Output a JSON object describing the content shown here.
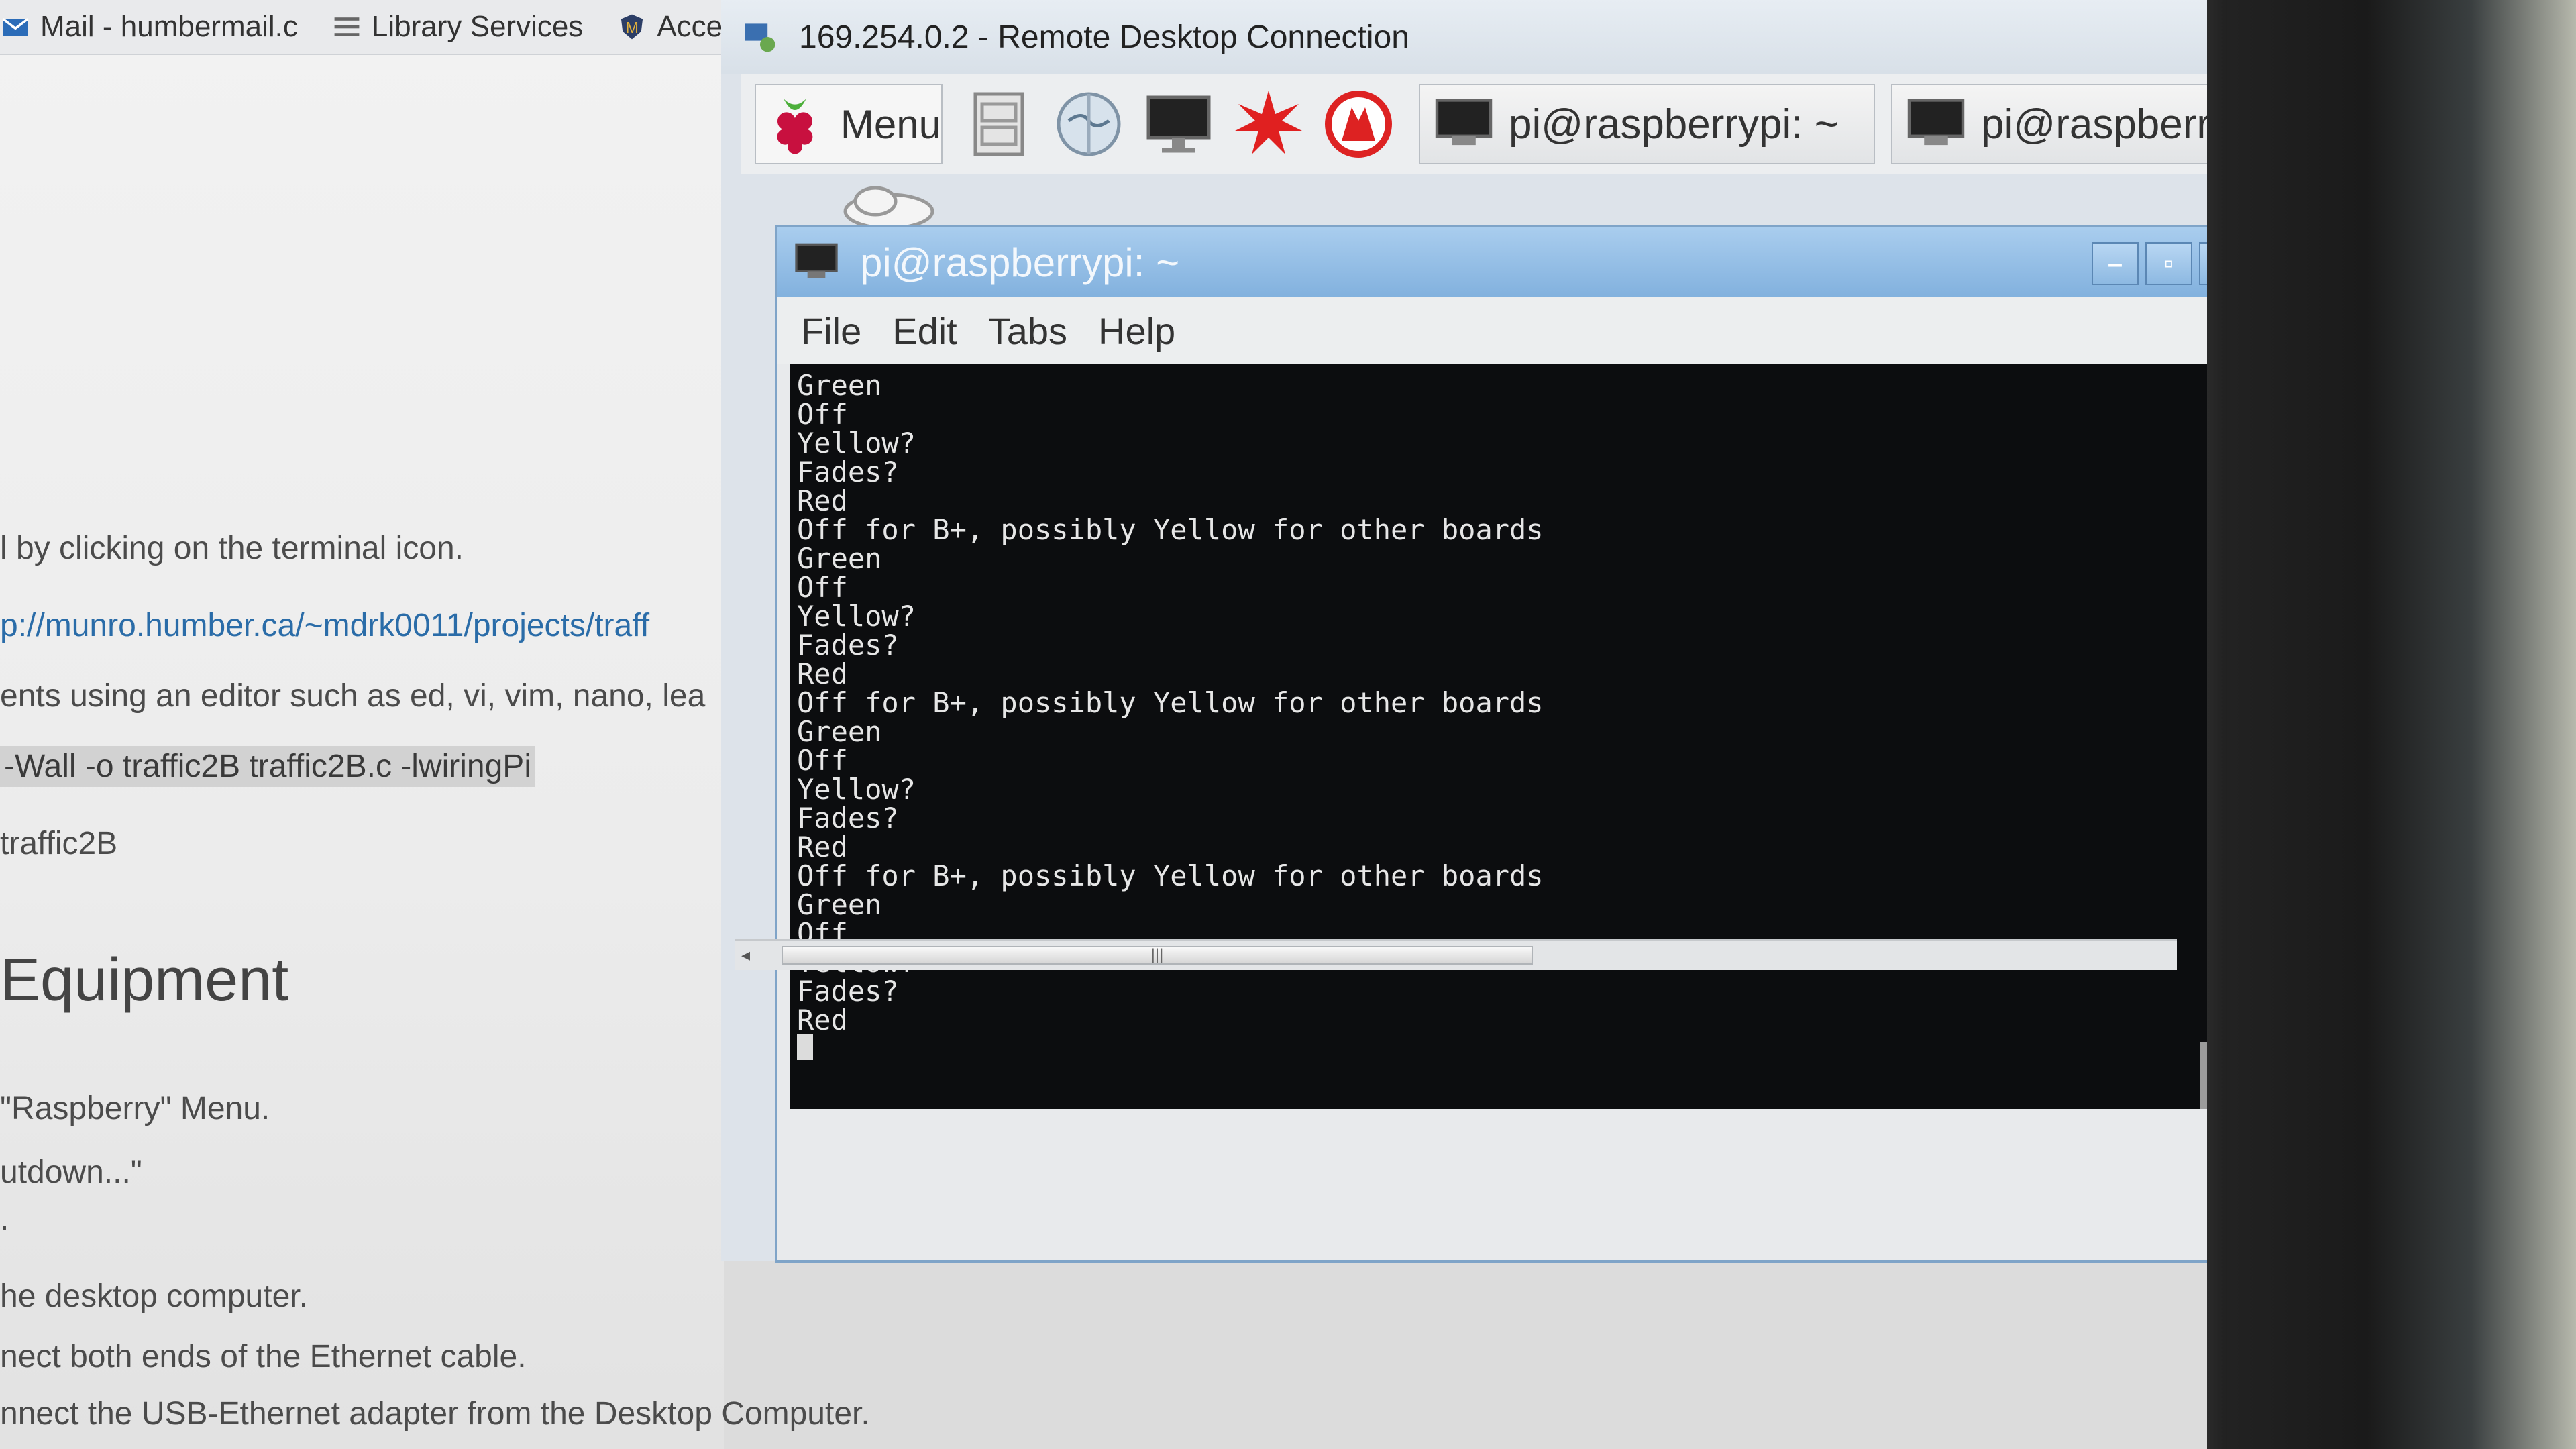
{
  "browser": {
    "bookmarks": [
      "Mail - humbermail.c",
      "Library Services",
      "Acceptab"
    ],
    "lines": {
      "terminal_icon": "l by clicking on the terminal icon.",
      "url": "p://munro.humber.ca/~mdrk0011/projects/traff",
      "editor": "ents using an editor such as ed, vi, vim, nano, lea",
      "compile": "-Wall -o traffic2B traffic2B.c -lwiringPi",
      "run": "traffic2B",
      "heading": "Equipment",
      "menu_step": "\"Raspberry\" Menu.",
      "shutdown": "utdown...\"",
      "dot": ".",
      "desktop": "he desktop computer.",
      "ethernet": "nect both ends of the Ethernet cable.",
      "adapter": "nnect the USB-Ethernet adapter from the Desktop Computer."
    }
  },
  "rdp": {
    "title": "169.254.0.2 - Remote Desktop Connection",
    "panel": {
      "menu_label": "Menu",
      "task1": "pi@raspberrypi: ~",
      "task2": "pi@raspberrypi: ~"
    }
  },
  "terminal": {
    "title": "pi@raspberrypi: ~",
    "menu": [
      "File",
      "Edit",
      "Tabs",
      "Help"
    ],
    "lines": [
      "Green",
      "Off",
      "Yellow?",
      "Fades?",
      "Red",
      "Off for B+, possibly Yellow for other boards",
      "Green",
      "Off",
      "Yellow?",
      "Fades?",
      "Red",
      "Off for B+, possibly Yellow for other boards",
      "Green",
      "Off",
      "Yellow?",
      "Fades?",
      "Red",
      "Off for B+, possibly Yellow for other boards",
      "Green",
      "Off",
      "Yellow?",
      "Fades?",
      "Red"
    ]
  },
  "colors": {
    "terminal_bg": "#0c0d0f",
    "terminal_fg": "#e6e6e6",
    "titlebar": "#82b1de",
    "raspberry_red": "#d4104a",
    "raspberry_green": "#5cc03a"
  }
}
